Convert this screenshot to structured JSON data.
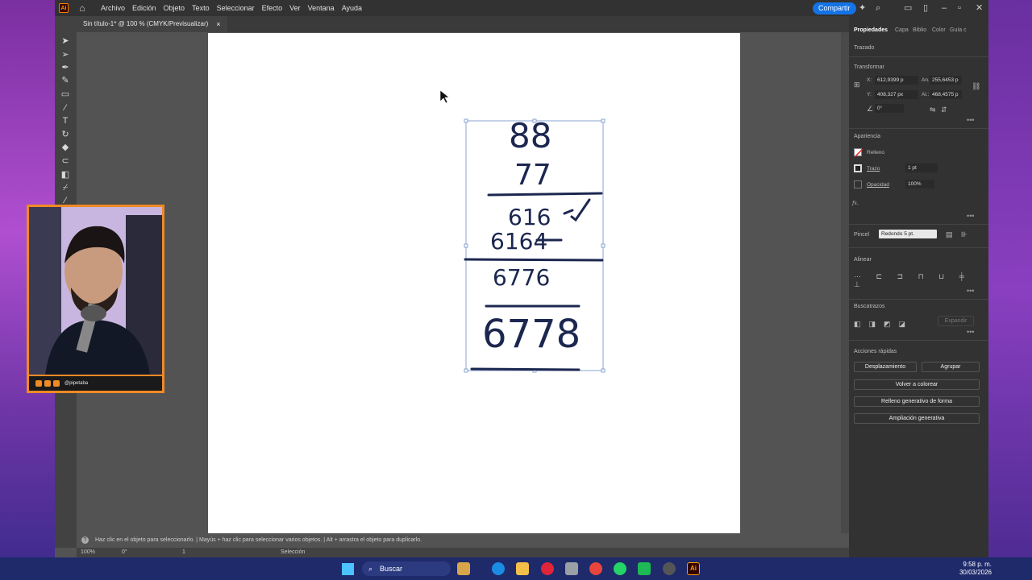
{
  "app": {
    "logo": "Ai",
    "menu": [
      "Archivo",
      "Edición",
      "Objeto",
      "Texto",
      "Seleccionar",
      "Efecto",
      "Ver",
      "Ventana",
      "Ayuda"
    ],
    "share_label": "Compartir",
    "doc_tab_title": "Sin título-1* @ 100 % (CMYK/Previsualizar)",
    "close_glyph": "×"
  },
  "panel": {
    "tabs": [
      "Propiedades",
      "Capa",
      "Biblio",
      "Color",
      "Guía c"
    ],
    "object_type": "Trazado",
    "transform_title": "Transformar",
    "x_label": "X:",
    "x_value": "612,9399 p",
    "y_label": "Y:",
    "y_value": "408,327 px",
    "w_label": "An.:",
    "w_value": "255,6453 p",
    "h_label": "Al.:",
    "h_value": "468,4575 p",
    "angle_value": "0°",
    "appearance_title": "Apariencia",
    "fill_label": "Relleno",
    "stroke_label": "Trazo",
    "stroke_value": "1 pt",
    "opacity_label": "Opacidad",
    "opacity_value": "100%",
    "fx_label": "fx.",
    "brush_label": "Pincel",
    "brush_value": "Redondo 5 pt.",
    "align_title": "Alinear",
    "pathfinder_title": "Buscatrazos",
    "expand_label": "Expandir",
    "quick_actions_title": "Acciones rápidas",
    "quick_actions": [
      "Desplazamiento",
      "Agrupar",
      "Volver a colorear",
      "Relleno generativo de forma",
      "Ampliación generativa"
    ]
  },
  "hint_text": "Haz clic en el objeto para seleccionarlo.  |  Mayús + haz clic para seleccionar varios objetos.  |  Alt + arrastra el objeto para duplicarlo.",
  "status": {
    "zoom": "100%",
    "rotation": "0°",
    "artboard_num": "1",
    "tool": "Selección"
  },
  "drawing": {
    "lines": [
      "88",
      "77",
      "616",
      "6164",
      "6776",
      "6778"
    ]
  },
  "webcam": {
    "handle": "@pipetaba"
  },
  "taskbar": {
    "search_label": "Buscar",
    "time": "9:58 p. m.",
    "date": "30/03/2026",
    "ai_icon": "Ai"
  }
}
